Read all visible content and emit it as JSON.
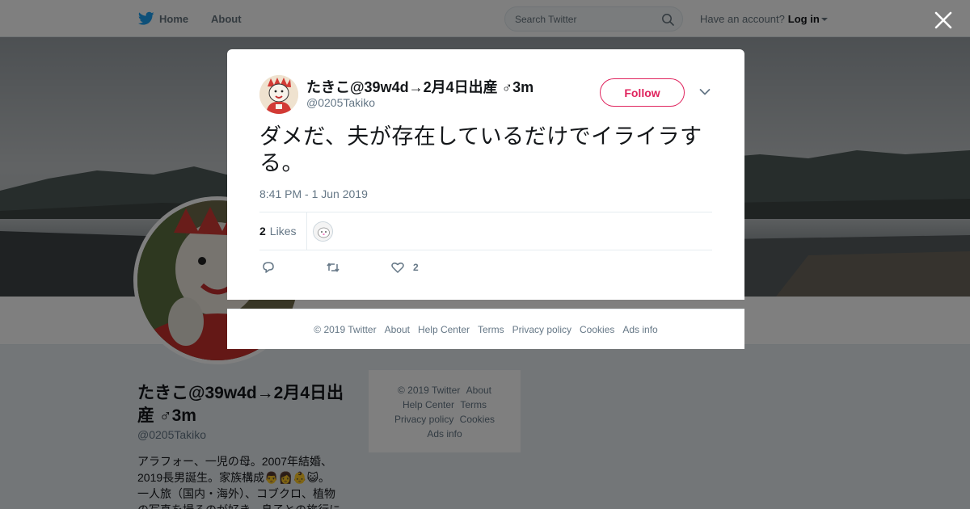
{
  "nav": {
    "home_label": "Home",
    "about_label": "About",
    "search_placeholder": "Search Twitter",
    "account_prompt": "Have an account?",
    "login_label": "Log in"
  },
  "profile": {
    "name": "たきこ@39w4d→2月4日出産 ♂3m",
    "handle": "@0205Takiko",
    "bio_lines": [
      "アラフォー、一児の母。2007年結婚、",
      "2019長男誕生。家族構成👨👩👶😺。",
      "一人旅（国内・海外）、コブクロ、植物",
      "の写真を撮るのが好き。息子との旅行に"
    ]
  },
  "side_footer": {
    "copyright": "© 2019 Twitter",
    "about": "About",
    "help": "Help Center",
    "terms": "Terms",
    "privacy": "Privacy policy",
    "cookies": "Cookies",
    "ads": "Ads info"
  },
  "tweet": {
    "author_name": "たきこ@39w4d→2月4日出産 ♂3m",
    "author_handle": "@0205Takiko",
    "follow_label": "Follow",
    "text": "ダメだ、夫が存在しているだけでイライラする。",
    "timestamp": "8:41 PM - 1 Jun 2019",
    "likes_count": "2",
    "likes_label": "Likes",
    "like_action_count": "2"
  },
  "modal_footer": {
    "copyright": "© 2019 Twitter",
    "about": "About",
    "help": "Help Center",
    "terms": "Terms",
    "privacy": "Privacy policy",
    "cookies": "Cookies",
    "ads": "Ads info"
  },
  "colors": {
    "brand_blue": "#1da1f2",
    "follow_accent": "#e0245e",
    "muted_text": "#657786"
  },
  "icons": {
    "logo": "twitter-bird-icon",
    "search": "search-icon",
    "close": "close-icon",
    "more": "chevron-down-icon",
    "reply": "reply-icon",
    "retweet": "retweet-icon",
    "like": "heart-icon"
  }
}
